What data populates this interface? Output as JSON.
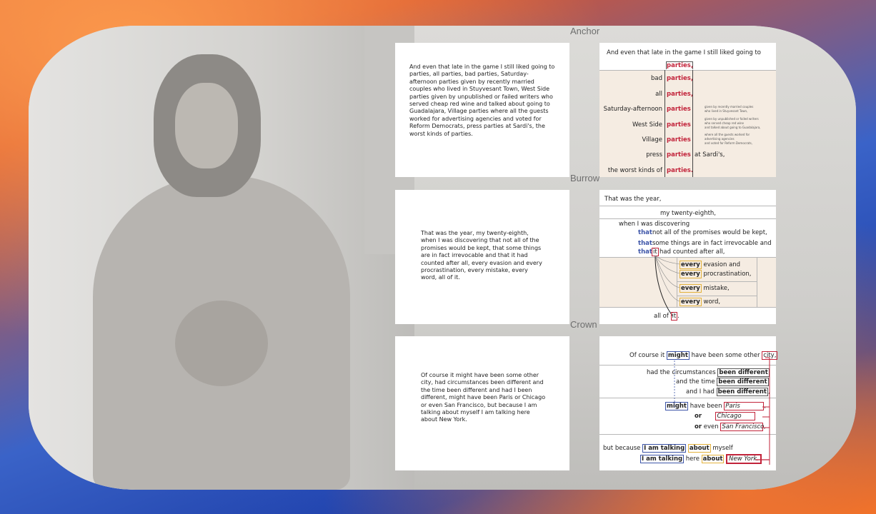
{
  "sections": {
    "anchor": {
      "label": "Anchor",
      "card_text": "And even that late in the game I still liked going to parties, all parties, bad parties, Saturday-afternoon parties given by recently married couples who lived in Stuyvesant Town, West Side parties given by unpublished or failed writers who served cheap red wine and talked about going to Guadalajara, Village parties where all the guests worked for advertising agencies and voted for Reform Democrats, press parties at Sardi's, the worst kinds of parties.",
      "viz": {
        "opening": "And even that late in the game I still liked going to",
        "rows": [
          {
            "prefix": "",
            "word": "parties,",
            "suffix": ""
          },
          {
            "prefix": "bad",
            "word": "parties,",
            "suffix": ""
          },
          {
            "prefix": "all",
            "word": "parties,",
            "suffix": ""
          },
          {
            "prefix": "Saturday-afternoon",
            "word": "parties",
            "suffix": ""
          },
          {
            "prefix": "West Side",
            "word": "parties",
            "suffix": ""
          },
          {
            "prefix": "Village",
            "word": "parties",
            "suffix": ""
          },
          {
            "prefix": "press",
            "word": "parties",
            "suffix": "at Sardi's,"
          },
          {
            "prefix": "the worst kinds of",
            "word": "parties.",
            "suffix": ""
          }
        ],
        "notes": [
          "given by recently married couples",
          "who lived in Stuyvesant Town,",
          "given by unpublished or failed writers",
          "who served cheap red wine",
          "and talked about going to Guadalajara,",
          "where all the guests worked for",
          "advertising agencies",
          "and voted for Reform Democrats,"
        ]
      }
    },
    "burrow": {
      "label": "Burrow",
      "card_text": "That was the year, my twenty-eighth, when I was discovering that not all of the promises would be kept, that some things are in fact irrevocable and that it had counted after all, every evasion and every procrastination, every mistake, every word, all of it.",
      "viz": {
        "line1": "That was the year,",
        "line2": "my twenty-eighth,",
        "line3": "when I was discovering",
        "that_1": "that",
        "line4": "not all of the promises would be kept,",
        "that_2": "that",
        "line5": "some things are in fact irrevocable and",
        "that_3": "that",
        "it_1": "it",
        "line6": "had counted after all,",
        "every_1": "every",
        "every_1_rest": "evasion and",
        "every_2": "every",
        "every_2_rest": "procrastination,",
        "every_3": "every",
        "every_3_rest": "mistake,",
        "every_4": "every",
        "every_4_rest": "word,",
        "allof": "all of",
        "it_2": "it",
        "period": "."
      }
    },
    "crown": {
      "label": "Crown",
      "card_text": "Of course it might have been some other city, had circumstances been different and the time been different and had I been different, might have been Paris or Chicago or even San Francisco, but because I am talking about myself I am talking here about New York.",
      "viz": {
        "l1a": "Of course it",
        "l1_might": "might",
        "l1b": "have been some other",
        "l1_city": "city,",
        "l2a": "had the circumstances",
        "l2_bd": "been different",
        "l3a": "and the time",
        "l3_bd": "been different",
        "l4a": "and I had",
        "l4_bd": "been different",
        "l4_comma": ",",
        "l5_might": "might",
        "l5a": "have been",
        "l5_paris": "Paris",
        "l5_comma": ",",
        "l6_or": "or",
        "l6_chicago": "Chicago",
        "l7_or": "or",
        "l7_even": "even",
        "l7_sf": "San Francisco,",
        "l8a": "but because",
        "l8_iat": "I am talking",
        "l8_about": "about",
        "l8_myself": "myself",
        "l9_iat": "I am talking",
        "l9_here": "here",
        "l9_about": "about",
        "l9_ny": "New York."
      }
    }
  },
  "colors": {
    "accent_red": "#c2233a",
    "accent_blue": "#3d55a8",
    "accent_yellow": "#e3b23c",
    "highlight_bg": "#f5ece2"
  }
}
